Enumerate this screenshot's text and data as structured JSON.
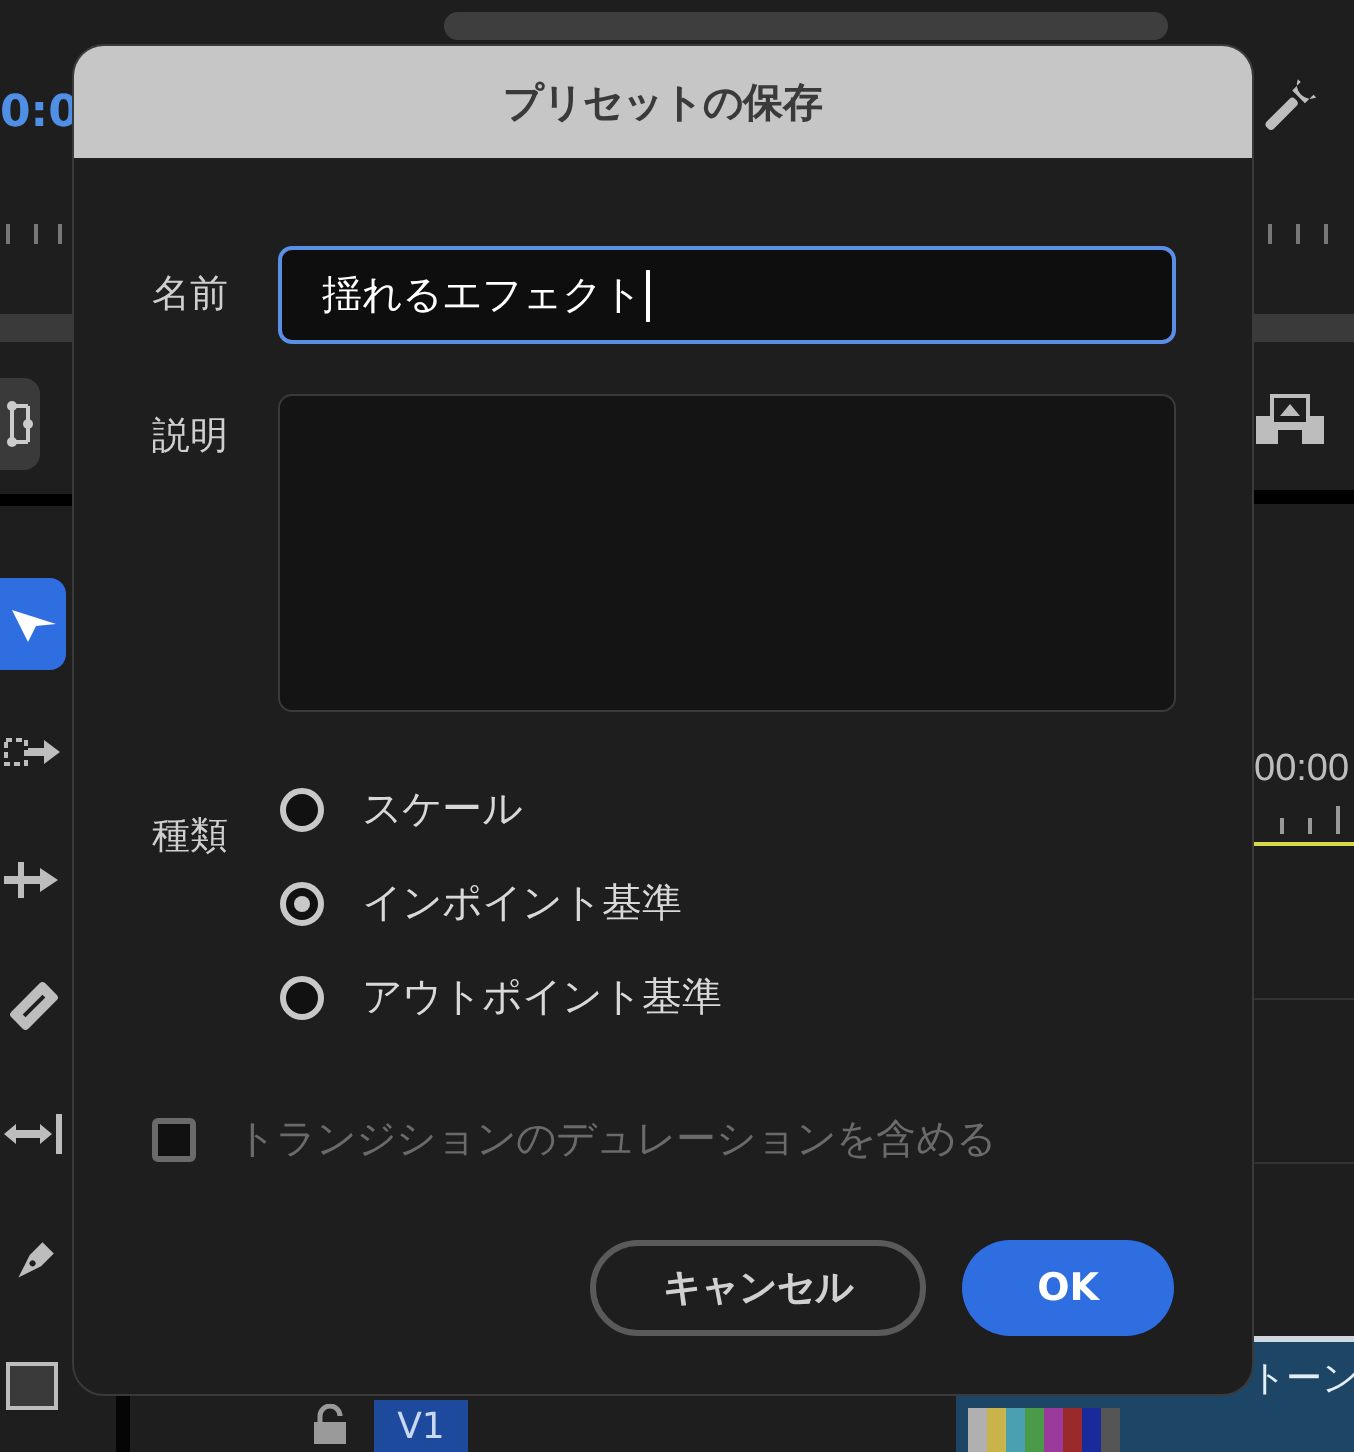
{
  "background": {
    "timecode_left": "0:0",
    "timecode_right": "00:00",
    "clip_label": "トーン",
    "track_label": "V1",
    "tools": [
      {
        "kind": "select",
        "selected": true
      },
      {
        "kind": "track-select",
        "selected": false
      },
      {
        "kind": "ripple",
        "selected": false
      },
      {
        "kind": "razor",
        "selected": false
      },
      {
        "kind": "slip",
        "selected": false
      },
      {
        "kind": "pen",
        "selected": false
      },
      {
        "kind": "rectangle",
        "selected": false
      }
    ]
  },
  "dialog": {
    "title": "プリセットの保存",
    "name": {
      "label": "名前",
      "value": "揺れるエフェクト",
      "focused": true
    },
    "description": {
      "label": "説明"
    },
    "type": {
      "label": "種類",
      "options": [
        {
          "label": "スケール",
          "selected": false
        },
        {
          "label": "インポイント基準",
          "selected": true
        },
        {
          "label": "アウトポイント基準",
          "selected": false
        }
      ]
    },
    "include_transition": {
      "label": "トランジションのデュレーションを含める",
      "checked": false,
      "disabled": true
    },
    "buttons": [
      {
        "label": "キャンセル",
        "kind": "secondary"
      },
      {
        "label": "OK",
        "kind": "primary"
      }
    ]
  }
}
